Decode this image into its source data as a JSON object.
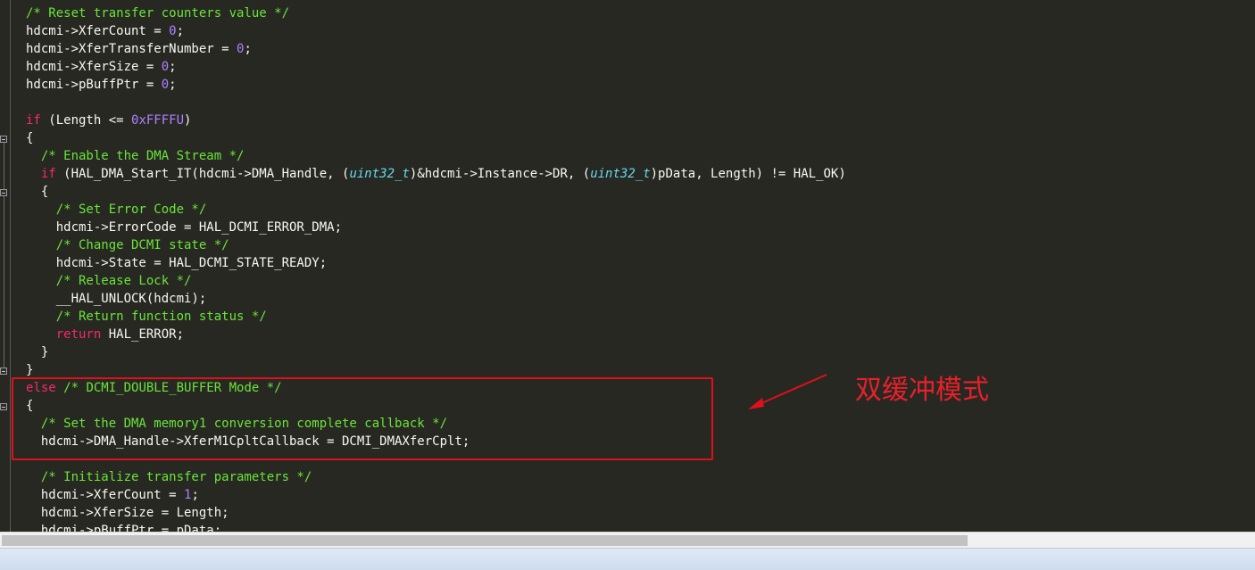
{
  "code_lines": [
    {
      "segments": [
        {
          "t": "/* Reset transfer counters value */",
          "c": "cm"
        }
      ]
    },
    {
      "segments": [
        {
          "t": "hdcmi->XferCount = "
        },
        {
          "t": "0",
          "c": "num"
        },
        {
          "t": ";"
        }
      ]
    },
    {
      "segments": [
        {
          "t": "hdcmi->XferTransferNumber = "
        },
        {
          "t": "0",
          "c": "num"
        },
        {
          "t": ";"
        }
      ]
    },
    {
      "segments": [
        {
          "t": "hdcmi->XferSize = "
        },
        {
          "t": "0",
          "c": "num"
        },
        {
          "t": ";"
        }
      ]
    },
    {
      "segments": [
        {
          "t": "hdcmi->pBuffPtr = "
        },
        {
          "t": "0",
          "c": "num"
        },
        {
          "t": ";"
        }
      ]
    },
    {
      "segments": []
    },
    {
      "segments": [
        {
          "t": "if",
          "c": "kw"
        },
        {
          "t": " (Length <= "
        },
        {
          "t": "0xFFFFU",
          "c": "num"
        },
        {
          "t": ")"
        }
      ]
    },
    {
      "segments": [
        {
          "t": "{"
        }
      ]
    },
    {
      "segments": [
        {
          "t": "  "
        },
        {
          "t": "/* Enable the DMA Stream */",
          "c": "cm"
        }
      ]
    },
    {
      "segments": [
        {
          "t": "  "
        },
        {
          "t": "if",
          "c": "kw"
        },
        {
          "t": " (HAL_DMA_Start_IT(hdcmi->DMA_Handle, ("
        },
        {
          "t": "uint32_t",
          "c": "ty"
        },
        {
          "t": ")&hdcmi->Instance->DR, ("
        },
        {
          "t": "uint32_t",
          "c": "ty"
        },
        {
          "t": ")pData, Length) != HAL_OK)"
        }
      ]
    },
    {
      "segments": [
        {
          "t": "  {"
        }
      ]
    },
    {
      "segments": [
        {
          "t": "    "
        },
        {
          "t": "/* Set Error Code */",
          "c": "cm"
        }
      ]
    },
    {
      "segments": [
        {
          "t": "    hdcmi->ErrorCode = HAL_DCMI_ERROR_DMA;"
        }
      ]
    },
    {
      "segments": [
        {
          "t": "    "
        },
        {
          "t": "/* Change DCMI state */",
          "c": "cm"
        }
      ]
    },
    {
      "segments": [
        {
          "t": "    hdcmi->State = HAL_DCMI_STATE_READY;"
        }
      ]
    },
    {
      "segments": [
        {
          "t": "    "
        },
        {
          "t": "/* Release Lock */",
          "c": "cm"
        }
      ]
    },
    {
      "segments": [
        {
          "t": "    __HAL_UNLOCK(hdcmi);"
        }
      ]
    },
    {
      "segments": [
        {
          "t": "    "
        },
        {
          "t": "/* Return function status */",
          "c": "cm"
        }
      ]
    },
    {
      "segments": [
        {
          "t": "    "
        },
        {
          "t": "return",
          "c": "kw"
        },
        {
          "t": " HAL_ERROR;"
        }
      ]
    },
    {
      "segments": [
        {
          "t": "  }"
        }
      ]
    },
    {
      "segments": [
        {
          "t": "}"
        }
      ]
    },
    {
      "segments": [
        {
          "t": "else",
          "c": "kw"
        },
        {
          "t": " "
        },
        {
          "t": "/* DCMI_DOUBLE_BUFFER Mode */",
          "c": "cm"
        }
      ]
    },
    {
      "segments": [
        {
          "t": "{"
        }
      ]
    },
    {
      "segments": [
        {
          "t": "  "
        },
        {
          "t": "/* Set the DMA memory1 conversion complete callback */",
          "c": "cm"
        }
      ]
    },
    {
      "segments": [
        {
          "t": "  hdcmi->DMA_Handle->XferM1CpltCallback = DCMI_DMAXferCplt;"
        }
      ]
    },
    {
      "segments": []
    },
    {
      "segments": [
        {
          "t": "  "
        },
        {
          "t": "/* Initialize transfer parameters */",
          "c": "cm"
        }
      ]
    },
    {
      "segments": [
        {
          "t": "  hdcmi->XferCount = "
        },
        {
          "t": "1",
          "c": "num"
        },
        {
          "t": ";"
        }
      ]
    },
    {
      "segments": [
        {
          "t": "  hdcmi->XferSize = Length;"
        }
      ]
    },
    {
      "segments": [
        {
          "t": "  hdcmi->pBuffPtr = pData;"
        }
      ]
    }
  ],
  "annotation": {
    "text": "双缓冲模式",
    "color": "#e8202a"
  },
  "colors": {
    "background": "#272822",
    "comment": "#6ae43a",
    "keyword": "#f92672",
    "number": "#ae81ff",
    "type": "#66d9ef",
    "default": "#f8f8f2"
  }
}
